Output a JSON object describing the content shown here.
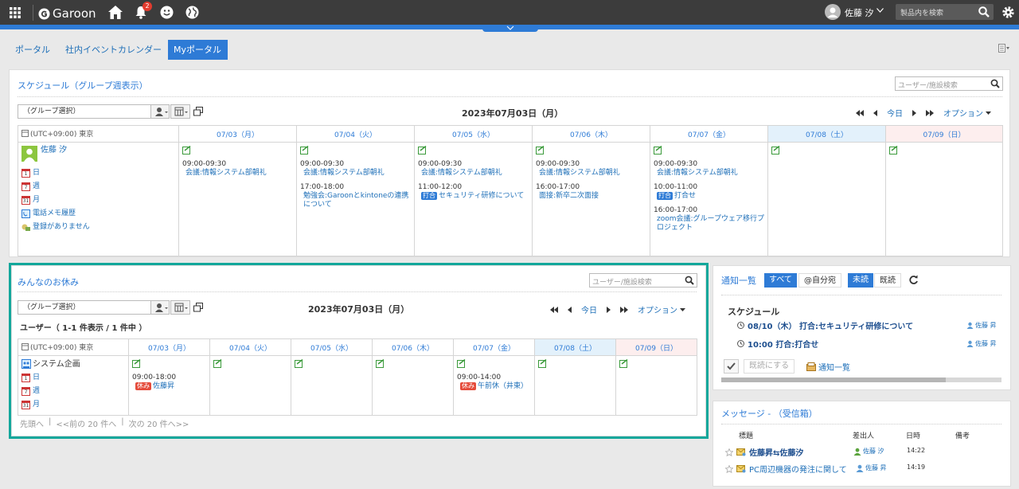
{
  "header": {
    "app_name": "Garoon",
    "notification_count": "2",
    "user_name": "佐藤 汐",
    "search_placeholder": "製品内を検索"
  },
  "tabs": [
    {
      "label": "ポータル"
    },
    {
      "label": "社内イベントカレンダー"
    },
    {
      "label": "Myポータル"
    }
  ],
  "schedule": {
    "title": "スケジュール（グループ週表示）",
    "search_placeholder": "ユーザー/施設検索",
    "group_select": "（グループ選択）",
    "date": "2023年07月03日（月）",
    "nav_today": "今日",
    "nav_option": "オプション",
    "timezone": "(UTC+09:00) 東京",
    "days": [
      "07/03（月）",
      "07/04（火）",
      "07/05（水）",
      "07/06（木）",
      "07/07（金）",
      "07/08（土）",
      "07/09（日）"
    ],
    "user": {
      "name": "佐藤 汐",
      "links": [
        "日",
        "週",
        "月",
        "電話メモ履歴",
        "登録がありません"
      ]
    },
    "events": {
      "d0": [
        {
          "time": "09:00-09:30",
          "title": "会議:情報システム部朝礼"
        }
      ],
      "d1": [
        {
          "time": "09:00-09:30",
          "title": "会議:情報システム部朝礼"
        },
        {
          "time": "17:00-18:00",
          "title": "勉強会:Garoonとkintoneの連携について"
        }
      ],
      "d2": [
        {
          "time": "09:00-09:30",
          "title": "会議:情報システム部朝礼"
        },
        {
          "time": "11:00-12:00",
          "badge": "打合",
          "title": "セキュリティ研修について"
        }
      ],
      "d3": [
        {
          "time": "09:00-09:30",
          "title": "会議:情報システム部朝礼"
        },
        {
          "time": "16:00-17:00",
          "title": "面接:新卒二次面接"
        }
      ],
      "d4": [
        {
          "time": "09:00-09:30",
          "title": "会議:情報システム部朝礼"
        },
        {
          "time": "10:00-11:00",
          "badge": "打合",
          "title": "打合せ"
        },
        {
          "time": "16:00-17:00",
          "title": "zoom会議:グループウェア移行プロジェクト"
        }
      ]
    }
  },
  "holiday": {
    "title": "みんなのお休み",
    "search_placeholder": "ユーザー/施設検索",
    "group_select": "（グループ選択）",
    "date": "2023年07月03日（月）",
    "nav_today": "今日",
    "nav_option": "オプション",
    "count_text": "ユーザー（ 1-1 件表示 / 1 件中 ）",
    "timezone": "(UTC+09:00) 東京",
    "days": [
      "07/03（月）",
      "07/04（火）",
      "07/05（水）",
      "07/06（木）",
      "07/07（金）",
      "07/08（土）",
      "07/09（日）"
    ],
    "org": {
      "name": "システム企画",
      "links": [
        "日",
        "週",
        "月"
      ]
    },
    "events": {
      "d0": {
        "time": "09:00-18:00",
        "badge": "休み",
        "title": "佐藤昇"
      },
      "d4": {
        "time": "09:00-14:00",
        "badge": "休み",
        "title": "午前休（井東）"
      }
    },
    "pager": {
      "first": "先頭へ",
      "prev": "<<前の 20 件へ",
      "next": "次の 20 件へ>>"
    }
  },
  "notifications": {
    "title": "通知一覧",
    "filter_all": "すべて",
    "filter_mine": "@自分宛",
    "filter_unread": "未読",
    "filter_read": "既読",
    "category": "スケジュール",
    "items": [
      {
        "text": "08/10（木） 打合:セキュリティ研修について",
        "user": "佐藤 昇"
      },
      {
        "text": "10:00 打合:打合せ",
        "user": "佐藤 昇"
      }
    ],
    "mark_read": "既読にする",
    "list_link": "通知一覧"
  },
  "messages": {
    "title": "メッセージ - （受信箱）",
    "headers": {
      "subject": "標題",
      "sender": "差出人",
      "time": "日時",
      "note": "備考"
    },
    "rows": [
      {
        "subject": "佐藤昇⇆佐藤汐",
        "sender": "佐藤 汐",
        "time": "14:22"
      },
      {
        "subject": "PC周辺機器の発注に関して",
        "sender": "佐藤 昇",
        "time": "14:19"
      }
    ]
  },
  "colors": {
    "accent": "#2e7bd6",
    "highlight": "#12a79b",
    "topbar": "#3c3c3c"
  }
}
